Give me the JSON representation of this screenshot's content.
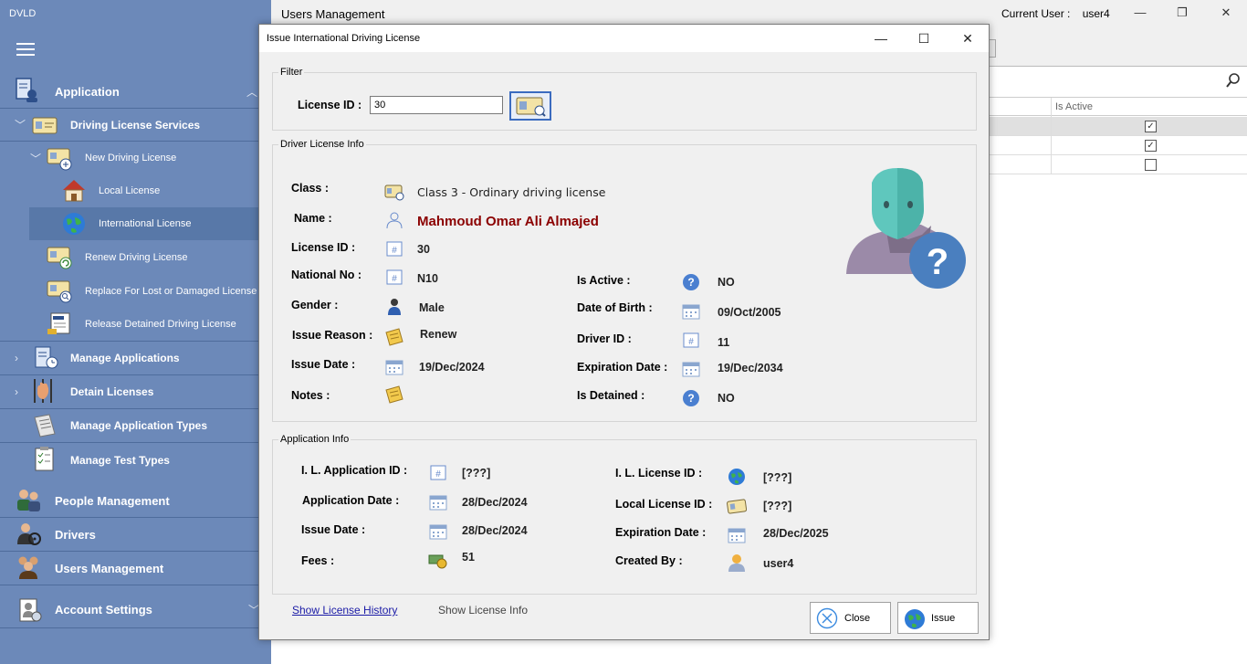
{
  "app": {
    "title": "DVLD"
  },
  "sidebar": {
    "items": [
      {
        "label": "Application",
        "icon": "application-document-icon"
      },
      {
        "label": "Driving License Services",
        "icon": "license-card-icon"
      },
      {
        "label": "New Driving License",
        "icon": "new-license-icon"
      },
      {
        "label": "Local License",
        "icon": "house-icon"
      },
      {
        "label": "International License",
        "icon": "globe-icon"
      },
      {
        "label": "Renew Driving License",
        "icon": "renew-license-icon"
      },
      {
        "label": "Replace For Lost or Damaged License",
        "icon": "replace-license-icon"
      },
      {
        "label": "Release Detained Driving License",
        "icon": "release-license-icon"
      },
      {
        "label": "Manage Applications",
        "icon": "applications-icon"
      },
      {
        "label": "Detain Licenses",
        "icon": "hand-bars-icon"
      },
      {
        "label": "Manage Application Types",
        "icon": "document-types-icon"
      },
      {
        "label": "Manage Test Types",
        "icon": "checklist-icon"
      },
      {
        "label": "People Management",
        "icon": "people-icon"
      },
      {
        "label": "Drivers",
        "icon": "drivers-icon"
      },
      {
        "label": "Users Management",
        "icon": "users-icon"
      },
      {
        "label": "Account Settings",
        "icon": "account-settings-icon"
      }
    ]
  },
  "main": {
    "title": "Users Management",
    "current_user_label": "Current User :",
    "current_user": "user4",
    "grid": {
      "column_is_active": "Is Active",
      "rows": [
        {
          "is_active": true,
          "selected": true
        },
        {
          "is_active": true,
          "selected": false
        },
        {
          "is_active": false,
          "selected": false
        }
      ]
    }
  },
  "dialog": {
    "title": "Issue International Driving License",
    "filter": {
      "legend": "Filter",
      "license_id_label": "License ID :",
      "license_id_value": "30"
    },
    "driver_license_info": {
      "legend": "Driver License Info",
      "class_label": "Class :",
      "class_value": "Class 3 - Ordinary driving license",
      "name_label": "Name :",
      "name_value": "Mahmoud Omar Ali Almajed",
      "license_id_label": "License ID :",
      "license_id_value": "30",
      "national_no_label": "National No :",
      "national_no_value": "N10",
      "gender_label": "Gender :",
      "gender_value": "Male",
      "issue_reason_label": "Issue Reason :",
      "issue_reason_value": "Renew",
      "issue_date_label": "Issue Date :",
      "issue_date_value": "19/Dec/2024",
      "notes_label": "Notes :",
      "notes_value": "",
      "is_active_label": "Is Active :",
      "is_active_value": "NO",
      "dob_label": "Date of Birth :",
      "dob_value": "09/Oct/2005",
      "driver_id_label": "Driver ID :",
      "driver_id_value": "11",
      "expiration_label": "Expiration Date :",
      "expiration_value": "19/Dec/2034",
      "is_detained_label": "Is Detained :",
      "is_detained_value": "NO"
    },
    "application_info": {
      "legend": "Application Info",
      "il_app_id_label": "I. L. Application ID :",
      "il_app_id_value": "[???]",
      "app_date_label": "Application Date :",
      "app_date_value": "28/Dec/2024",
      "issue_date_label": "Issue Date :",
      "issue_date_value": "28/Dec/2024",
      "fees_label": "Fees :",
      "fees_value": "51",
      "il_license_id_label": "I. L. License ID :",
      "il_license_id_value": "[???]",
      "local_license_id_label": "Local License ID :",
      "local_license_id_value": "[???]",
      "expiration_label": "Expiration Date :",
      "expiration_value": "28/Dec/2025",
      "created_by_label": "Created By :",
      "created_by_value": "user4"
    },
    "links": {
      "show_history": "Show License History",
      "show_info": "Show License Info"
    },
    "buttons": {
      "close": "Close",
      "issue": "Issue"
    }
  },
  "colors": {
    "sidebar": "#6c89b9",
    "name_value": "#8b0000",
    "link": "#1a1aa6"
  }
}
